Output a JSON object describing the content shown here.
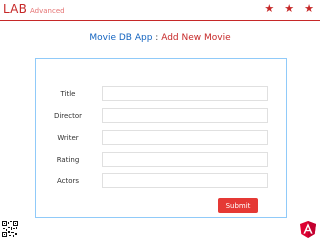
{
  "brand": {
    "lab": "LAB",
    "level": "Advanced",
    "rating_stars": 3
  },
  "colors": {
    "accent": "#c62828",
    "link": "#1565c0",
    "button": "#e53935",
    "panel_border": "#90caf9"
  },
  "heading": {
    "app": "Movie DB App",
    "separator": ":",
    "page": "Add New Movie"
  },
  "form": {
    "fields": [
      {
        "label": "Title",
        "value": ""
      },
      {
        "label": "Director",
        "value": ""
      },
      {
        "label": "Writer",
        "value": ""
      },
      {
        "label": "Rating",
        "value": ""
      },
      {
        "label": "Actors",
        "value": ""
      }
    ],
    "submit_label": "Submit"
  },
  "icons": {
    "stars": "star-icon",
    "qr": "qr-code-icon",
    "logo": "angular-logo-icon"
  }
}
